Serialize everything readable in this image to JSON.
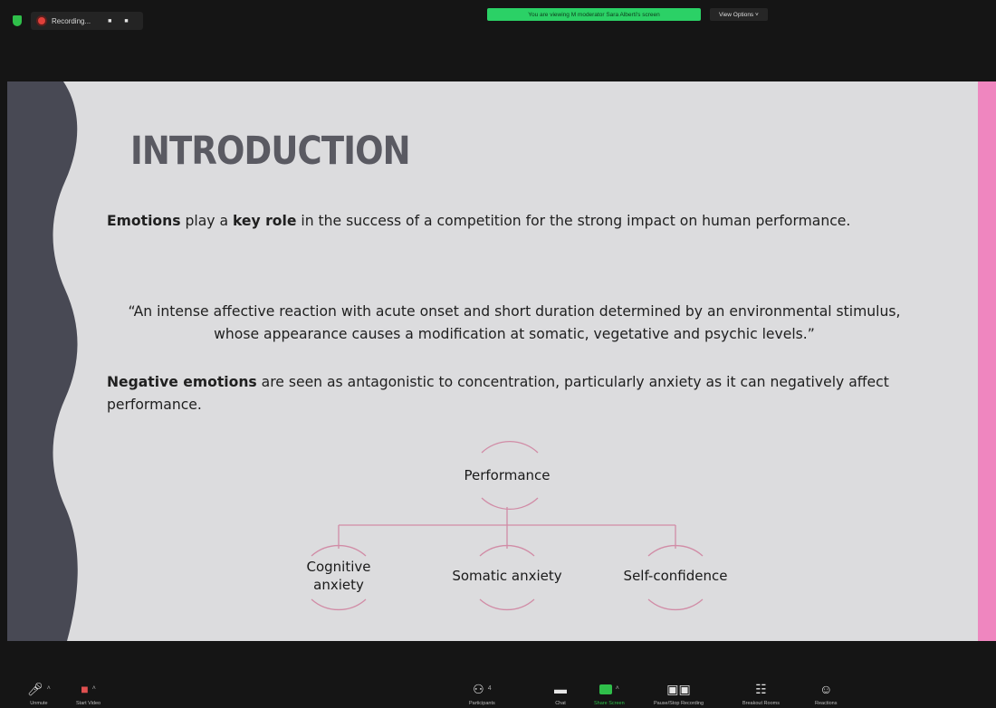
{
  "top_bar": {
    "recording_label": "Recording...",
    "recording_controls": "■ ■",
    "viewing_banner": "You are viewing M moderator Sara Alberti's screen",
    "view_options_label": "View Options ˅"
  },
  "slide": {
    "title": "INTRODUCTION",
    "p1_bold_1": "Emotions",
    "p1_text_1": " play a ",
    "p1_bold_2": "key role",
    "p1_text_2": " in the success of a competition for the strong impact on human performance.",
    "quote": "“An intense affective reaction with acute onset and short duration determined by an environmental stimulus, whose appearance causes a modification at somatic, vegetative and psychic levels.”",
    "p2_bold": "Negative emotions",
    "p2_text": " are seen as antagonistic to concentration, particularly anxiety as it can negatively affect performance.",
    "diagram": {
      "root": "Performance",
      "children": [
        "Cognitive anxiety",
        "Somatic anxiety",
        "Self-confidence"
      ],
      "line_color": "#d18ca6"
    },
    "accent_color": "#ef86bf",
    "wave_color": "#484954"
  },
  "toolbar": {
    "unmute_label": "Unmute",
    "start_video_label": "Start Video",
    "participants_label": "Participants",
    "participants_count": "4",
    "chat_label": "Chat",
    "share_screen_label": "Share Screen",
    "recording_label": "Pause/Stop Recording",
    "breakout_label": "Breakout Rooms",
    "reactions_label": "Reactions"
  }
}
